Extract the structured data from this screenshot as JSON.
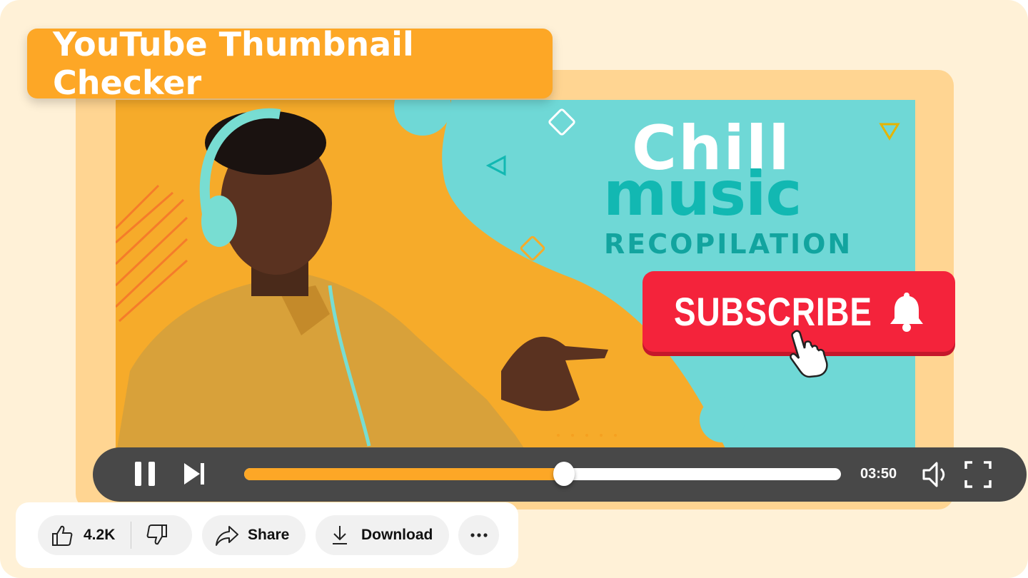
{
  "banner": {
    "title": "YouTube Thumbnail Checker"
  },
  "thumbnail": {
    "title_line1": "Chill",
    "title_line2": "music",
    "title_line3": "RECOPILATION",
    "subscribe_label": "SUBSCRIBE",
    "colors": {
      "background": "#f6ab2a",
      "blob": "#6fd8d6",
      "subscribe": "#f4233b"
    }
  },
  "player": {
    "time": "03:50",
    "progress": 0.536,
    "accent": "#fda726",
    "icons": [
      "pause-icon",
      "skip-next-icon",
      "volume-icon",
      "fullscreen-icon"
    ]
  },
  "actions": {
    "likes": "4.2K",
    "share_label": "Share",
    "download_label": "Download"
  }
}
